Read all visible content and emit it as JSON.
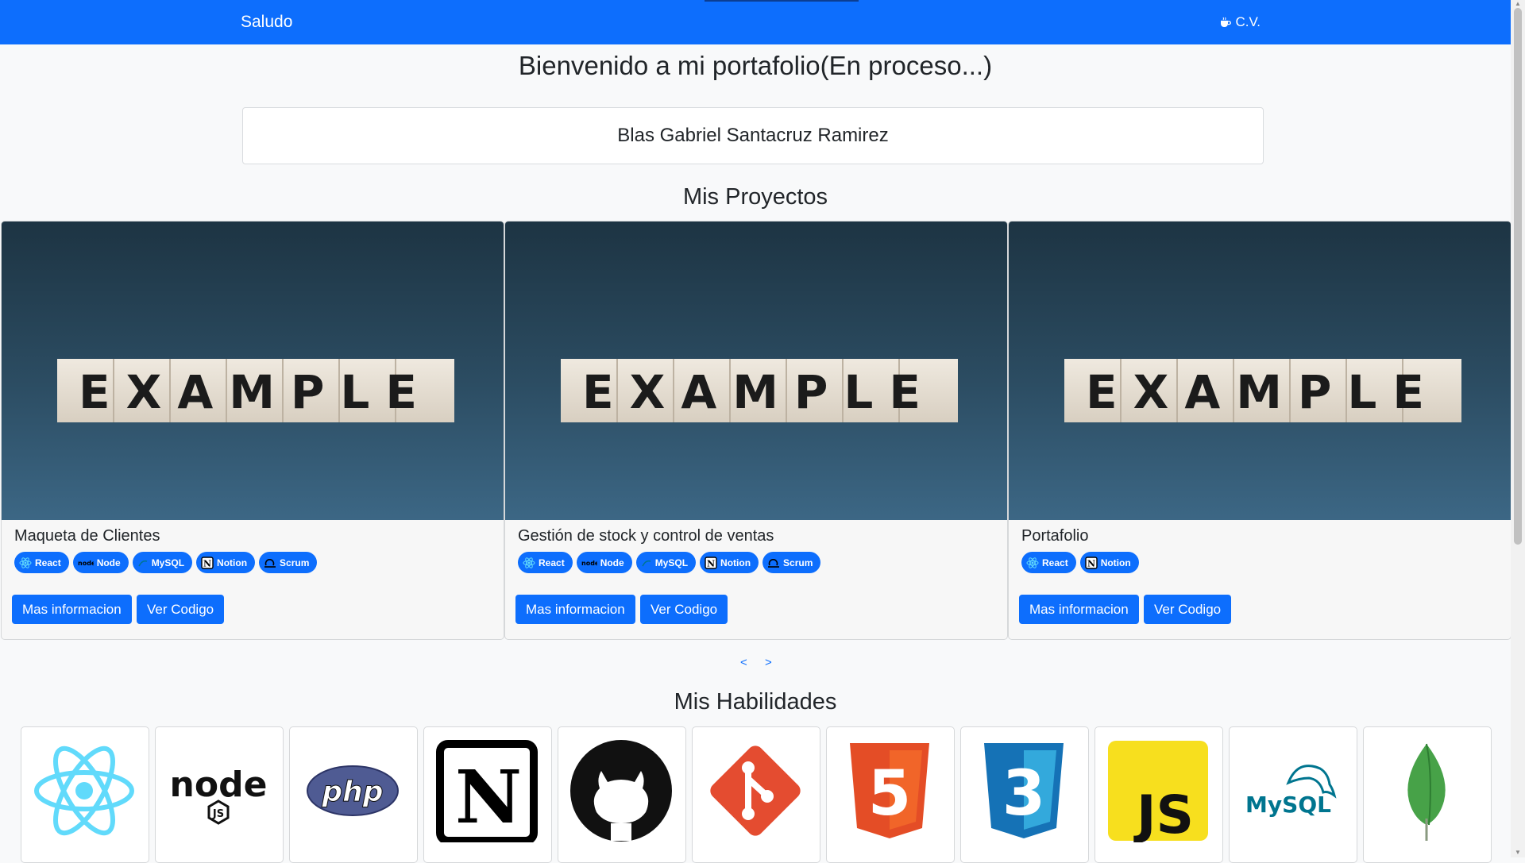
{
  "navbar": {
    "brand": "Saludo",
    "cv_label": "C.V.",
    "cv_icon": "coffee-icon"
  },
  "welcome": "Bienvenido a mi portafolio(En proceso...)",
  "name": "Blas Gabriel Santacruz Ramirez",
  "projects_title": "Mis Proyectos",
  "image_text": "EXAMPLE",
  "projects": [
    {
      "title": "Maqueta de Clientes",
      "badges": [
        "React",
        "Node",
        "MySQL",
        "Notion",
        "Scrum"
      ],
      "more_label": "Mas informacion",
      "code_label": "Ver Codigo"
    },
    {
      "title": "Gestión de stock y control de ventas",
      "badges": [
        "React",
        "Node",
        "MySQL",
        "Notion",
        "Scrum"
      ],
      "more_label": "Mas informacion",
      "code_label": "Ver Codigo"
    },
    {
      "title": "Portafolio",
      "badges": [
        "React",
        "Notion"
      ],
      "more_label": "Mas informacion",
      "code_label": "Ver Codigo"
    }
  ],
  "carousel": {
    "prev": "<",
    "next": ">"
  },
  "skills_title": "Mis Habilidades",
  "skills": [
    {
      "icon": "react-icon",
      "logo_text": ""
    },
    {
      "icon": "nodejs-icon",
      "logo_text": "node"
    },
    {
      "icon": "php-icon",
      "logo_text": "php"
    },
    {
      "icon": "notion-icon",
      "logo_text": "N"
    },
    {
      "icon": "github-icon",
      "logo_text": ""
    },
    {
      "icon": "git-icon",
      "logo_text": ""
    },
    {
      "icon": "html5-icon",
      "logo_text": "5"
    },
    {
      "icon": "css3-icon",
      "logo_text": "3"
    },
    {
      "icon": "javascript-icon",
      "logo_text": "JS"
    },
    {
      "icon": "mysql-icon",
      "logo_text": "MySQL"
    },
    {
      "icon": "mongodb-icon",
      "logo_text": ""
    }
  ],
  "colors": {
    "primary": "#0d6efd",
    "background": "#f8f9fa"
  }
}
